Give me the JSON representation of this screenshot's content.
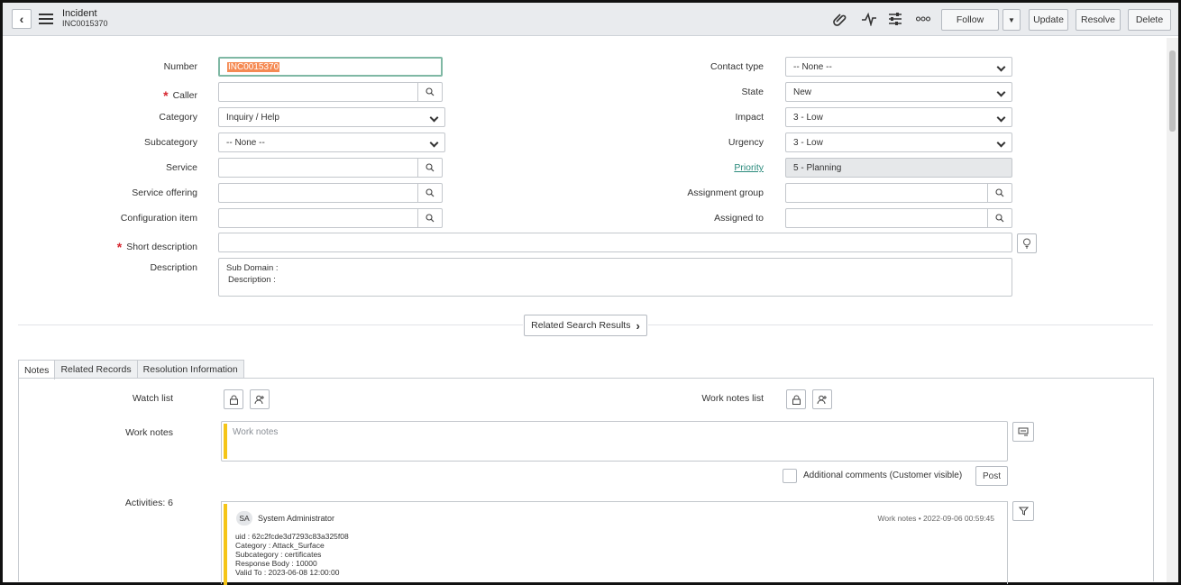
{
  "header": {
    "title": "Incident",
    "number": "INC0015370",
    "buttons": {
      "follow": "Follow",
      "update": "Update",
      "resolve": "Resolve",
      "delete": "Delete"
    }
  },
  "form": {
    "left": {
      "number": {
        "label": "Number",
        "value": "INC0015370"
      },
      "caller": {
        "label": "Caller",
        "value": ""
      },
      "category": {
        "label": "Category",
        "value": "Inquiry / Help"
      },
      "subcategory": {
        "label": "Subcategory",
        "value": "-- None --"
      },
      "service": {
        "label": "Service",
        "value": ""
      },
      "service_offering": {
        "label": "Service offering",
        "value": ""
      },
      "configuration_item": {
        "label": "Configuration item",
        "value": ""
      }
    },
    "right": {
      "contact_type": {
        "label": "Contact type",
        "value": "-- None --"
      },
      "state": {
        "label": "State",
        "value": "New"
      },
      "impact": {
        "label": "Impact",
        "value": "3 - Low"
      },
      "urgency": {
        "label": "Urgency",
        "value": "3 - Low"
      },
      "priority": {
        "label": "Priority",
        "value": "5 - Planning"
      },
      "assignment_group": {
        "label": "Assignment group",
        "value": ""
      },
      "assigned_to": {
        "label": "Assigned to",
        "value": ""
      }
    },
    "short_description": {
      "label": "Short description",
      "value": ""
    },
    "description": {
      "label": "Description",
      "line1": "Sub Domain :",
      "line2": "Description :"
    }
  },
  "related_search": {
    "label": "Related Search Results"
  },
  "tabs": [
    {
      "label": "Notes"
    },
    {
      "label": "Related Records"
    },
    {
      "label": "Resolution Information"
    }
  ],
  "notes": {
    "watch_list_label": "Watch list",
    "work_notes_list_label": "Work notes list",
    "work_notes_label": "Work notes",
    "work_notes_placeholder": "Work notes",
    "additional_comments_label": "Additional comments (Customer visible)",
    "post_label": "Post",
    "activities_label": "Activities: 6"
  },
  "activity": {
    "initials": "SA",
    "author": "System Administrator",
    "meta": "Work notes  •  2022-09-06 00:59:45",
    "lines": [
      "uid : 62c2fcde3d7293c83a325f08",
      "Category : Attack_Surface",
      "Subcategory : certificates",
      "Response Body : 10000",
      "Valid To : 2023-06-08 12:00:00"
    ]
  },
  "colors": {
    "required": "#d7262f",
    "accent_bar": "#f5c518",
    "link": "#2a8a7c",
    "highlight": "#f58a53"
  }
}
